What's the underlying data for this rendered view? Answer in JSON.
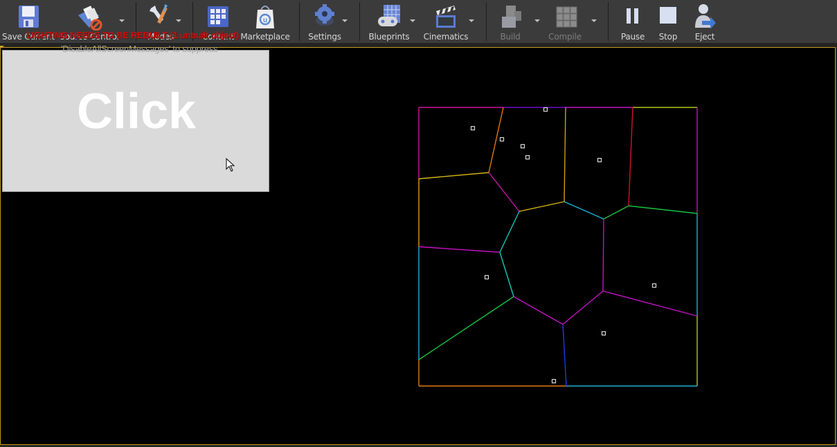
{
  "toolbar": {
    "buttons": [
      {
        "id": "save-current",
        "label": "Save Current",
        "icon": "floppy-disk-icon",
        "dropdown": false,
        "enabled": true
      },
      {
        "id": "source-control",
        "label": "Source Control",
        "icon": "source-control-icon",
        "dropdown": true,
        "enabled": true
      },
      {
        "id": "modes",
        "label": "Modes",
        "icon": "modes-tools-icon",
        "dropdown": true,
        "enabled": true
      },
      {
        "id": "content",
        "label": "Content",
        "icon": "content-browser-icon",
        "dropdown": false,
        "enabled": true
      },
      {
        "id": "marketplace",
        "label": "Marketplace",
        "icon": "marketplace-bag-icon",
        "dropdown": false,
        "enabled": true
      },
      {
        "id": "settings",
        "label": "Settings",
        "icon": "settings-gear-icon",
        "dropdown": true,
        "enabled": true
      },
      {
        "id": "blueprints",
        "label": "Blueprints",
        "icon": "blueprints-gamepad-icon",
        "dropdown": true,
        "enabled": true
      },
      {
        "id": "cinematics",
        "label": "Cinematics",
        "icon": "clapperboard-icon",
        "dropdown": true,
        "enabled": true
      },
      {
        "id": "build",
        "label": "Build",
        "icon": "build-blocks-icon",
        "dropdown": true,
        "enabled": false
      },
      {
        "id": "compile",
        "label": "Compile",
        "icon": "compile-cubes-icon",
        "dropdown": true,
        "enabled": false
      },
      {
        "id": "pause",
        "label": "Pause",
        "icon": "pause-icon",
        "dropdown": false,
        "enabled": true
      },
      {
        "id": "stop",
        "label": "Stop",
        "icon": "stop-icon",
        "dropdown": false,
        "enabled": true
      },
      {
        "id": "eject",
        "label": "Eject",
        "icon": "eject-person-icon",
        "dropdown": false,
        "enabled": true
      }
    ]
  },
  "viewport": {
    "border_color": "#c69b1b",
    "messages": {
      "lighting_warning": "LIGHTING NEEDS TO BE REBUILT (1 unbuilt object)",
      "suppress_hint": "'DisableAllScreenMessages' to suppress",
      "overlay_text": "Click"
    },
    "colors": {
      "warning": "#c41212",
      "panel_bg": "#dadada"
    }
  },
  "voronoi": {
    "site_count": 10,
    "cell_count": 10,
    "edge_colors": [
      "#d4129a",
      "#6a0fc9",
      "#e07a10",
      "#d4b414",
      "#c9a214",
      "#c4127c",
      "#18b4d4",
      "#d4b414",
      "#d01426",
      "#14c43c",
      "#c412c4",
      "#14c8b4",
      "#14c43c",
      "#c412c4",
      "#1a3ce0",
      "#b4c414",
      "#e07a10"
    ]
  }
}
